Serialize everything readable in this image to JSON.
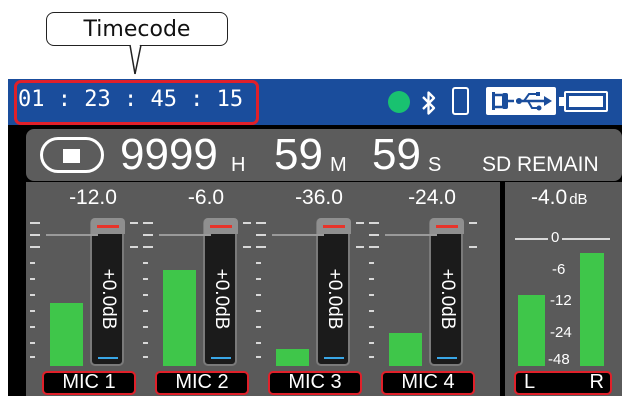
{
  "callout": {
    "label": "Timecode"
  },
  "topbar": {
    "timecode": "01 : 23 : 45 : 15",
    "icons": [
      "recording-status-icon",
      "bluetooth-icon",
      "smartphone-icon",
      "usb-power-icon",
      "battery-icon"
    ],
    "colors": {
      "bar": "#1a4d9c",
      "status_dot": "#19c270",
      "highlight": "#e0202a"
    }
  },
  "remain": {
    "hours": "9999",
    "hours_unit": "H",
    "minutes": "59",
    "minutes_unit": "M",
    "seconds": "59",
    "seconds_unit": "S",
    "label": "SD REMAIN"
  },
  "channels": [
    {
      "name": "MIC 1",
      "level": "-12.0",
      "fader": "+0.0dB",
      "meter_fill": 0.42
    },
    {
      "name": "MIC 2",
      "level": "-6.0",
      "fader": "+0.0dB",
      "meter_fill": 0.64
    },
    {
      "name": "MIC 3",
      "level": "-36.0",
      "fader": "+0.0dB",
      "meter_fill": 0.11
    },
    {
      "name": "MIC 4",
      "level": "-24.0",
      "fader": "+0.0dB",
      "meter_fill": 0.22
    }
  ],
  "master": {
    "level": "-4.0",
    "unit": "dB",
    "scale": [
      "0",
      "-6",
      "-12",
      "-24",
      "-48"
    ],
    "left_label": "L",
    "right_label": "R",
    "left_fill": 0.47,
    "right_fill": 0.75
  }
}
